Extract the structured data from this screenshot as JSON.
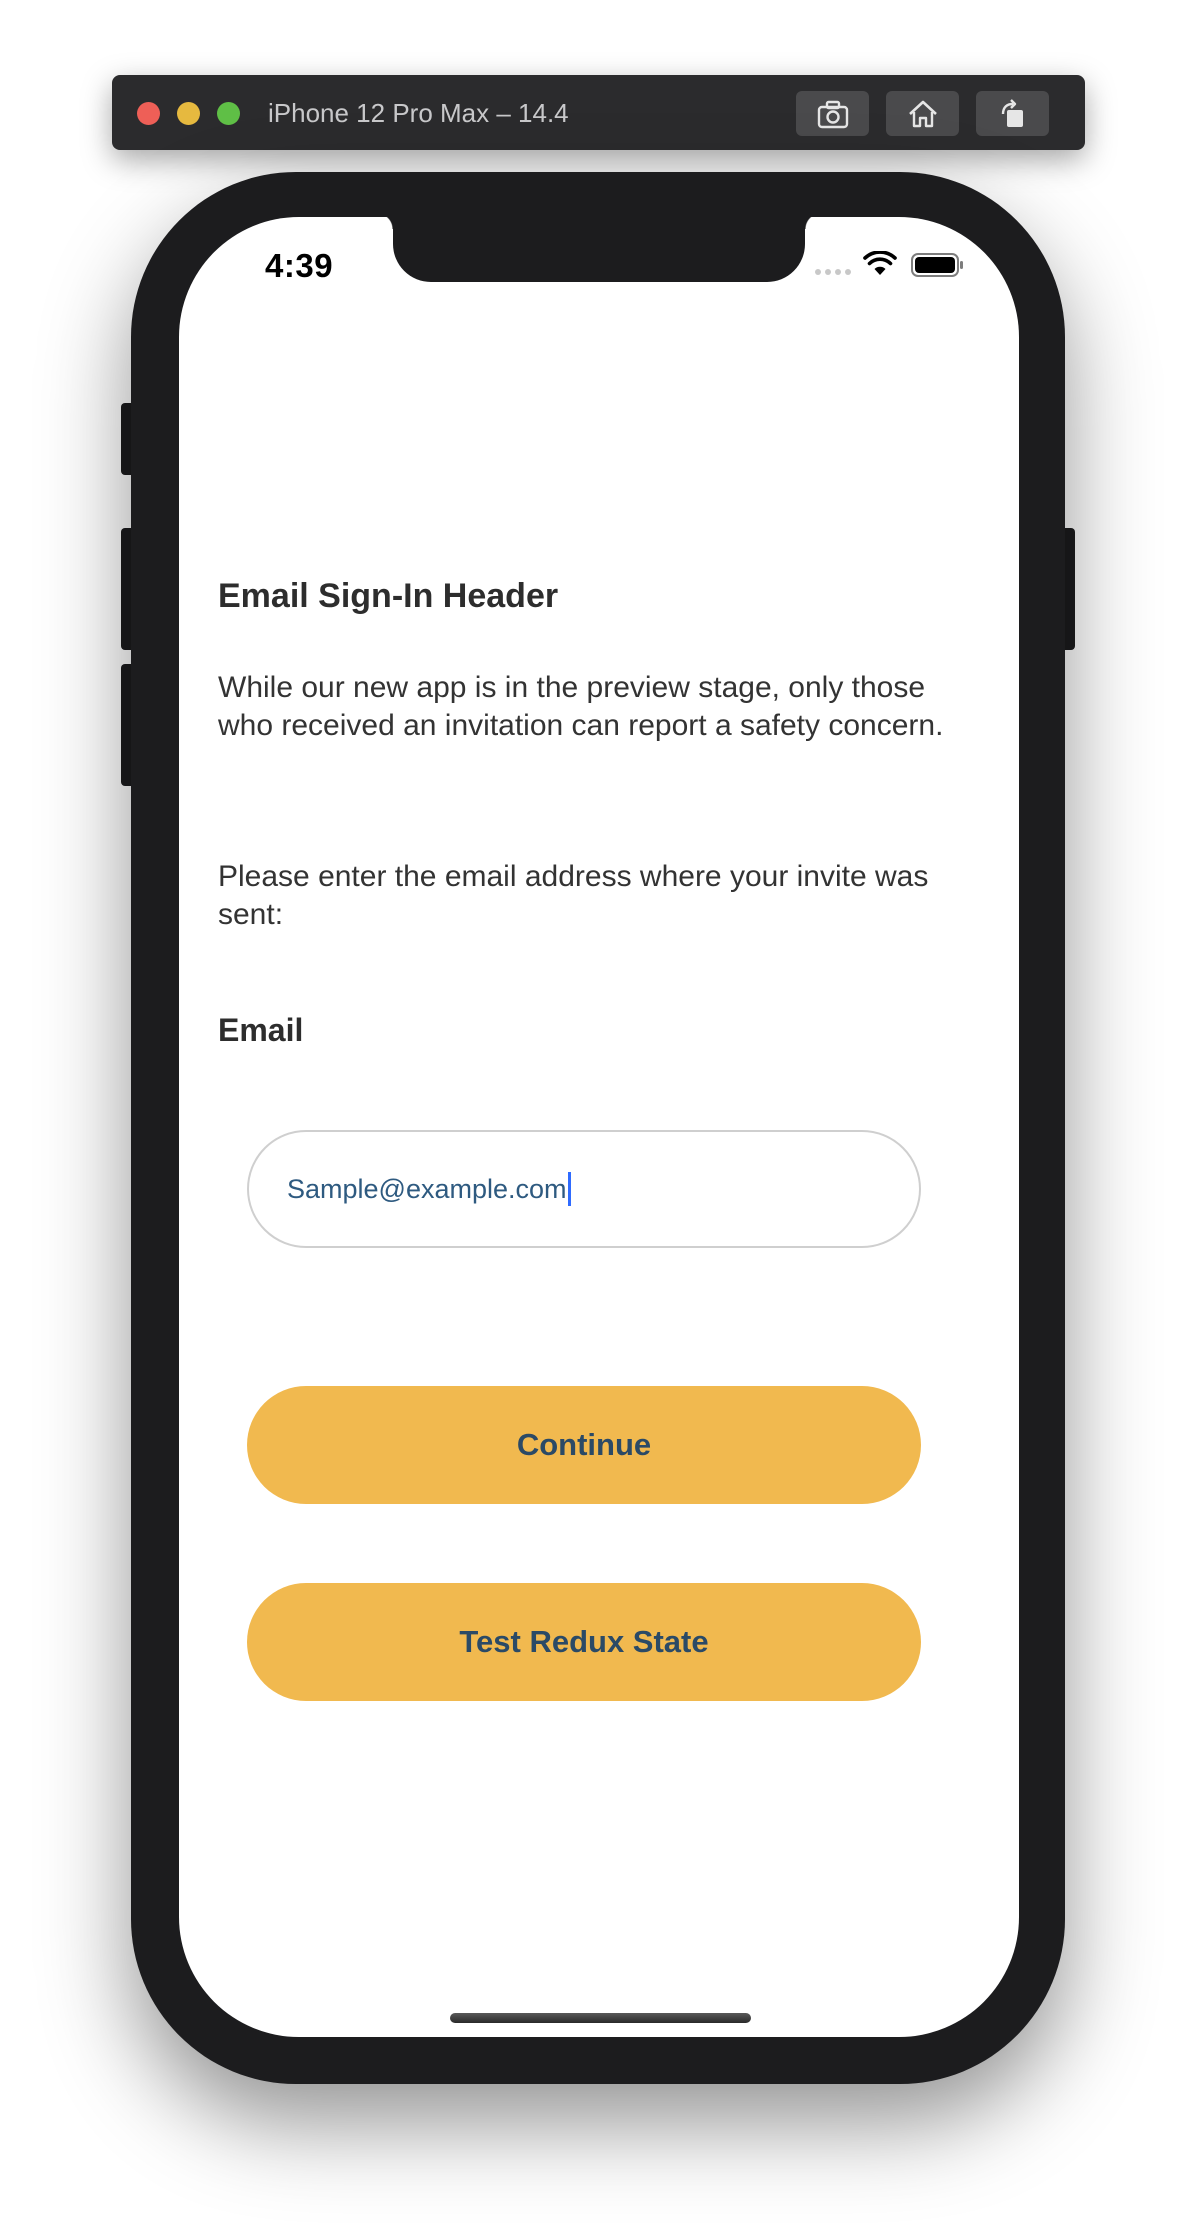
{
  "simulator": {
    "title": "iPhone 12 Pro Max – 14.4",
    "buttons": [
      "screenshot-icon",
      "home-icon",
      "rotate-icon"
    ]
  },
  "status_bar": {
    "time": "4:39"
  },
  "screen": {
    "header": "Email Sign-In Header",
    "paragraph_1": "While our new app is in the preview stage, only those who received an invitation can report a safety concern.",
    "paragraph_2": "Please enter the email address where your invite was sent:",
    "email_label": "Email",
    "email_value": "Sample@example.com",
    "continue_label": "Continue",
    "redux_label": "Test Redux State"
  },
  "colors": {
    "button_bg": "#f1b94f",
    "button_text": "#2b4a66",
    "input_text": "#2e5a80",
    "caret": "#2f6bff"
  }
}
